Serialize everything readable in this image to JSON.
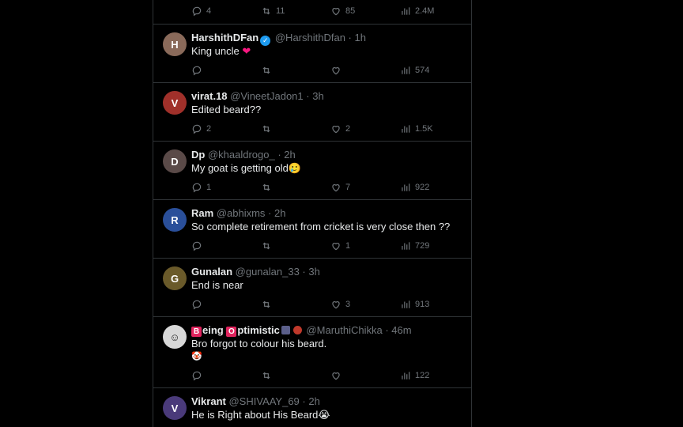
{
  "top_actions": {
    "reply": "4",
    "retweet": "11",
    "like": "85",
    "views": "2.4M"
  },
  "tweets": [
    {
      "name": "HarshithDFan",
      "handle": "@HarshithDfan",
      "time": "1h",
      "text": "King uncle",
      "emoji": "❤",
      "reply": "",
      "retweet": "",
      "like": "",
      "views": "574",
      "avatar_color": "#8a6a5a"
    },
    {
      "name": "virat.18",
      "handle": "@VineetJadon1",
      "time": "3h",
      "text": "Edited beard??",
      "reply": "2",
      "retweet": "",
      "like": "2",
      "views": "1.5K",
      "avatar_color": "#a0302a"
    },
    {
      "name": "Dp",
      "handle": "@khaaldrogo_",
      "time": "2h",
      "text": "My goat is getting old",
      "emoji": "🥲",
      "reply": "1",
      "retweet": "",
      "like": "7",
      "views": "922",
      "avatar_color": "#5a4a48"
    },
    {
      "name": "Ram",
      "handle": "@abhixms",
      "time": "2h",
      "text": "So complete retirement from cricket is very close then ??",
      "reply": "",
      "retweet": "",
      "like": "1",
      "views": "729",
      "avatar_color": "#2a4f9a"
    },
    {
      "name": "Gunalan",
      "handle": "@gunalan_33",
      "time": "3h",
      "text": "End is near",
      "reply": "",
      "retweet": "",
      "like": "3",
      "views": "913",
      "avatar_color": "#6a5a2a"
    },
    {
      "name_parts": [
        "B",
        "eing ",
        "O",
        "ptimistic"
      ],
      "handle": "@MaruthiChikka",
      "time": "46m",
      "text": "Bro forgot to colour his beard.",
      "emoji": "🤡",
      "reply": "",
      "retweet": "",
      "like": "",
      "views": "122",
      "avatar_color": "#d8d8d8"
    },
    {
      "name": "Vikrant",
      "handle": "@SHIVAAY_69",
      "time": "2h",
      "text": "He is Right about His Beard",
      "emoji": "😭",
      "avatar_color": "#4a3a7a"
    }
  ]
}
